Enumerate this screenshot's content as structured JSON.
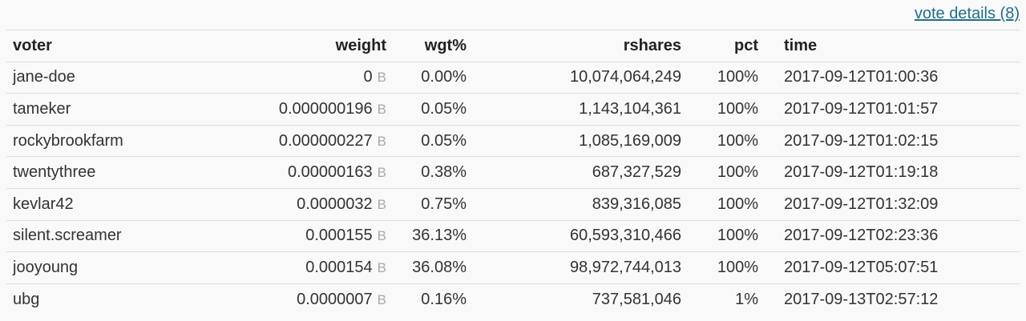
{
  "vote_details_link": "vote details (8)",
  "columns": {
    "voter": "voter",
    "weight": "weight",
    "wgt_pct": "wgt%",
    "rshares": "rshares",
    "pct": "pct",
    "time": "time"
  },
  "rows": [
    {
      "voter": "jane-doe",
      "weight": "0",
      "unit": "B",
      "wgt_pct": "0.00%",
      "rshares": "10,074,064,249",
      "pct": "100%",
      "time": "2017-09-12T01:00:36"
    },
    {
      "voter": "tameker",
      "weight": "0.000000196",
      "unit": "B",
      "wgt_pct": "0.05%",
      "rshares": "1,143,104,361",
      "pct": "100%",
      "time": "2017-09-12T01:01:57"
    },
    {
      "voter": "rockybrookfarm",
      "weight": "0.000000227",
      "unit": "B",
      "wgt_pct": "0.05%",
      "rshares": "1,085,169,009",
      "pct": "100%",
      "time": "2017-09-12T01:02:15"
    },
    {
      "voter": "twentythree",
      "weight": "0.00000163",
      "unit": "B",
      "wgt_pct": "0.38%",
      "rshares": "687,327,529",
      "pct": "100%",
      "time": "2017-09-12T01:19:18"
    },
    {
      "voter": "kevlar42",
      "weight": "0.0000032",
      "unit": "B",
      "wgt_pct": "0.75%",
      "rshares": "839,316,085",
      "pct": "100%",
      "time": "2017-09-12T01:32:09"
    },
    {
      "voter": "silent.screamer",
      "weight": "0.000155",
      "unit": "B",
      "wgt_pct": "36.13%",
      "rshares": "60,593,310,466",
      "pct": "100%",
      "time": "2017-09-12T02:23:36"
    },
    {
      "voter": "jooyoung",
      "weight": "0.000154",
      "unit": "B",
      "wgt_pct": "36.08%",
      "rshares": "98,972,744,013",
      "pct": "100%",
      "time": "2017-09-12T05:07:51"
    },
    {
      "voter": "ubg",
      "weight": "0.0000007",
      "unit": "B",
      "wgt_pct": "0.16%",
      "rshares": "737,581,046",
      "pct": "1%",
      "time": "2017-09-13T02:57:12"
    }
  ]
}
